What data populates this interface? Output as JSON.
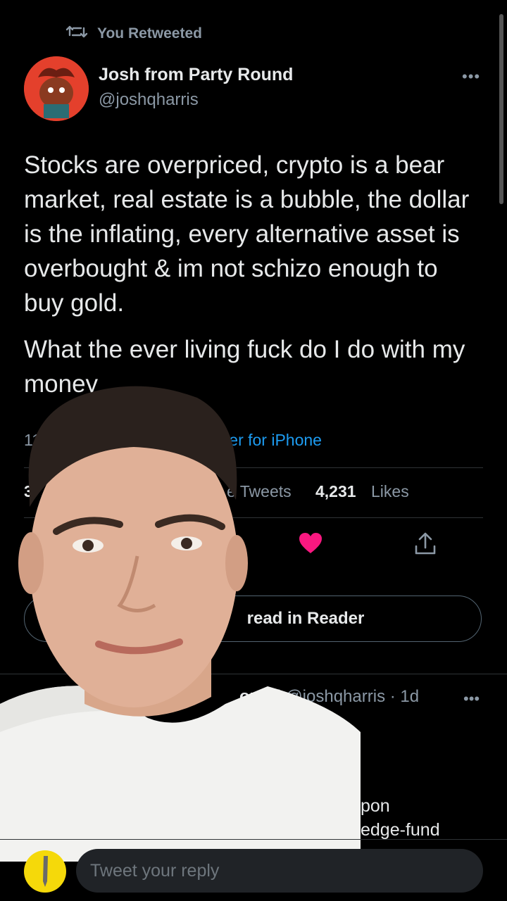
{
  "retweet": {
    "label": "You Retweeted"
  },
  "tweet": {
    "author_name": "Josh from Party Round",
    "author_handle": "@joshqharris",
    "text_p1": "Stocks are overpriced, crypto is a bear market, real estate is a bubble, the dollar is the inflating, every alternative asset is overbought & im not schizo enough to buy gold.",
    "text_p2": "What the ever living fuck do I do with my money",
    "time_partial": "11:",
    "source": "Twitter for iPhone",
    "stats": {
      "retweets_partial": "3",
      "quote_label_partial": "e Tweets",
      "likes_count": "4,231",
      "likes_label": "Likes"
    },
    "liked": true,
    "reader_button_label": "read in Reader"
  },
  "reply": {
    "name_partial": "ound",
    "handle": "@joshqharris",
    "age": "· 1d",
    "line1": "pon",
    "line2": "edge-fund"
  },
  "composer": {
    "placeholder": "Tweet your reply"
  },
  "colors": {
    "accent": "#1d9bf0",
    "like": "#f91880",
    "background": "#000000"
  }
}
